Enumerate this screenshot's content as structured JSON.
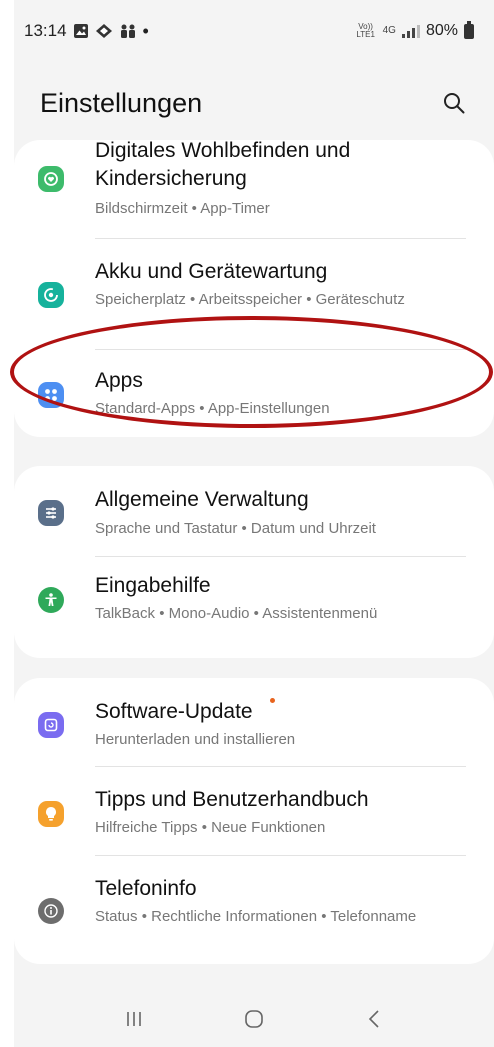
{
  "status_bar": {
    "time": "13:14",
    "volte": "Vo)) LTE1",
    "network": "4G",
    "battery": "80%"
  },
  "header": {
    "title": "Einstellungen",
    "search_icon": "search-icon"
  },
  "groups": [
    {
      "items": [
        {
          "title": "Digitales Wohlbefinden und Kindersicherung",
          "subtitle": "Bildschirmzeit • App-Timer",
          "icon": "wellbeing-icon",
          "color": "#3dbb6b"
        },
        {
          "title": "Akku und Gerätewartung",
          "subtitle": "Speicherplatz • Arbeitsspeicher • Geräteschutz",
          "icon": "device-care-icon",
          "color": "#16b29c"
        },
        {
          "title": "Apps",
          "subtitle": "Standard-Apps • App-Einstellungen",
          "icon": "apps-icon",
          "color": "#4d8ff2"
        }
      ]
    },
    {
      "items": [
        {
          "title": "Allgemeine Verwaltung",
          "subtitle": "Sprache und Tastatur • Datum und Uhrzeit",
          "icon": "general-management-icon",
          "color": "#5a6f8a"
        },
        {
          "title": "Eingabehilfe",
          "subtitle": "TalkBack • Mono-Audio • Assistentenmenü",
          "icon": "accessibility-icon",
          "color": "#2fa95a"
        }
      ]
    },
    {
      "items": [
        {
          "title": "Software-Update",
          "subtitle": "Herunterladen und installieren",
          "icon": "software-update-icon",
          "color": "#7a6cf0"
        },
        {
          "title": "Tipps und Benutzerhandbuch",
          "subtitle": "Hilfreiche Tipps • Neue Funktionen",
          "icon": "tips-icon",
          "color": "#f5a12d"
        },
        {
          "title": "Telefoninfo",
          "subtitle": "Status • Rechtliche Informationen • Telefonname",
          "icon": "phone-info-icon",
          "color": "#6d6d6d"
        }
      ]
    }
  ],
  "highlight_color": "#b01212",
  "nav": {
    "recents_icon": "recents-icon",
    "home_icon": "home-icon",
    "back_icon": "back-icon"
  }
}
